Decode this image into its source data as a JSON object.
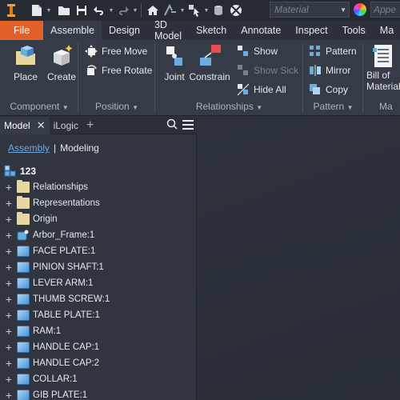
{
  "qat": {
    "material_placeholder": "Material",
    "appearance_placeholder": "Appe"
  },
  "tabs": [
    "File",
    "Assemble",
    "Design",
    "3D Model",
    "Sketch",
    "Annotate",
    "Inspect",
    "Tools",
    "Ma"
  ],
  "ribbon": {
    "component": {
      "place": "Place",
      "create": "Create",
      "label": "Component"
    },
    "position": {
      "free_move": "Free Move",
      "free_rotate": "Free Rotate",
      "label": "Position"
    },
    "relationships": {
      "joint": "Joint",
      "constrain": "Constrain",
      "show": "Show",
      "show_sick": "Show Sick",
      "hide_all": "Hide All",
      "label": "Relationships"
    },
    "pattern": {
      "pattern": "Pattern",
      "mirror": "Mirror",
      "copy": "Copy",
      "label": "Pattern"
    },
    "bom": {
      "line1": "Bill of",
      "line2": "Material",
      "label": "Ma"
    }
  },
  "browser": {
    "tab_model": "Model",
    "tab_ilogic": "iLogic",
    "view_assembly": "Assembly",
    "view_modeling": "Modeling",
    "root": "123",
    "items": [
      {
        "label": "Relationships",
        "type": "folder"
      },
      {
        "label": "Representations",
        "type": "folder"
      },
      {
        "label": "Origin",
        "type": "folder"
      },
      {
        "label": "Arbor_Frame:1",
        "type": "part"
      },
      {
        "label": "FACE PLATE:1",
        "type": "part"
      },
      {
        "label": "PINION SHAFT:1",
        "type": "part"
      },
      {
        "label": "LEVER ARM:1",
        "type": "part"
      },
      {
        "label": "THUMB SCREW:1",
        "type": "part"
      },
      {
        "label": "TABLE PLATE:1",
        "type": "part"
      },
      {
        "label": "RAM:1",
        "type": "part"
      },
      {
        "label": "HANDLE CAP:1",
        "type": "part"
      },
      {
        "label": "HANDLE CAP:2",
        "type": "part"
      },
      {
        "label": "COLLAR:1",
        "type": "part"
      },
      {
        "label": "GIB PLATE:1",
        "type": "part"
      }
    ]
  }
}
